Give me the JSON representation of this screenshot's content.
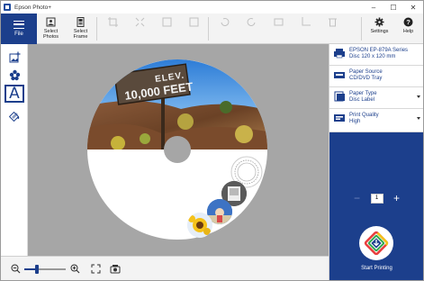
{
  "window": {
    "title": "Epson Photo+",
    "minimize": "–",
    "maximize": "☐",
    "close": "✕"
  },
  "ribbon": {
    "file_label": "File",
    "select_photos": "Select\nPhotos",
    "select_frame": "Select\nFrame",
    "settings": "Settings",
    "help": "Help"
  },
  "left_tools": [
    "add-image-tool",
    "stamp-tool",
    "text-tool",
    "background-tool"
  ],
  "text_tool_glyph": "A",
  "disc": {
    "sign_line1": "ELEV.",
    "sign_line2": "10,000 FEET"
  },
  "zoom": {
    "level": 0.3
  },
  "panel": {
    "printer_title": "EPSON EP-879A Series",
    "printer_value": "Disc 120 x 120 mm",
    "source_title": "Paper Source",
    "source_value": "CD/DVD Tray",
    "type_title": "Paper Type",
    "type_value": "Disc Label",
    "quality_title": "Print Quality",
    "quality_value": "High",
    "copies_minus": "−",
    "copies": "1",
    "copies_plus": "+",
    "print_label": "Start Printing"
  },
  "colors": {
    "accent": "#1c3f8c",
    "canvas_bg": "#a6a6a6"
  }
}
